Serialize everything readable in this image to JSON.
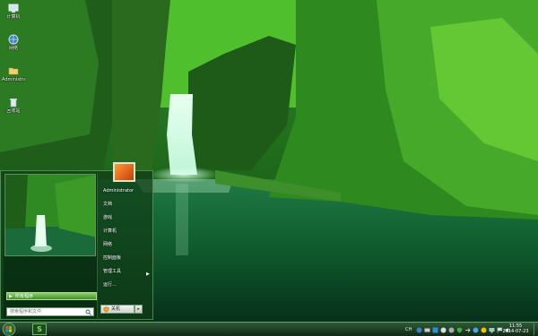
{
  "desktop": {
    "icons": [
      {
        "label": "计算机",
        "icon": "computer-icon"
      },
      {
        "label": "网络",
        "icon": "network-icon"
      },
      {
        "label": "Administrato...",
        "icon": "user-folder-icon"
      },
      {
        "label": "回收站",
        "icon": "recycle-bin-icon"
      }
    ]
  },
  "start_menu": {
    "all_programs": "所有程序",
    "search_placeholder": "搜索程序和文件",
    "user_name": "Administrator",
    "items": [
      "文档",
      "游戏",
      "计算机",
      "网络",
      "控制面板",
      "管理工具",
      "运行..."
    ],
    "shutdown_label": "关机"
  },
  "taskbar": {
    "pinned_app_label": "S",
    "language": "CH",
    "time": "11:55",
    "date": "2014-07-23"
  },
  "colors": {
    "accent": "#3f8f2f",
    "taskbar": "#1c3f22"
  }
}
